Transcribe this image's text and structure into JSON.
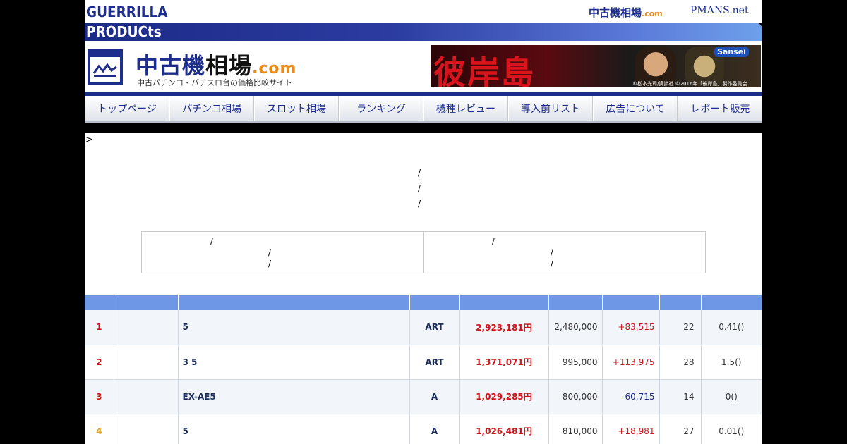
{
  "brand": {
    "line1": "GUERRILLA",
    "line2": "PRODUCts"
  },
  "top_links": {
    "site1_main": "中古機相場",
    "site1_com": ".com",
    "site2": "PMANS.net"
  },
  "header": {
    "site_name_a": "中古機",
    "site_name_b": "相場",
    "site_name_com": ".com",
    "tagline": "中古パチンコ・パチスロ台の価格比較サイト"
  },
  "banner": {
    "title": "彼岸島",
    "brand": "Sansei",
    "copyright": "©松本光司/講談社 ©2016年「彼岸島」製作委員会"
  },
  "nav": [
    "トップページ",
    "パチンコ相場",
    "スロット相場",
    "ランキング",
    "機種レビュー",
    "導入前リスト",
    "広告について",
    "レポート販売"
  ],
  "content": {
    "gt": ">",
    "slash": "/"
  },
  "colors": {
    "brand_blue": "#1d2d8c",
    "price_red": "#d0121b",
    "header_blue": "#6e97e6",
    "accent_orange": "#e98a1b"
  },
  "ranking": [
    {
      "rank": "1",
      "rank_color": "#d0121b",
      "name": "5",
      "type": "ART",
      "price": "2,923,181円",
      "prev": "2,480,000",
      "diff": "+83,515",
      "diff_color": "#d0121b",
      "count": "22",
      "ratio": "0.41()"
    },
    {
      "rank": "2",
      "rank_color": "#d0121b",
      "name": "3 5",
      "type": "ART",
      "price": "1,371,071円",
      "prev": "995,000",
      "diff": "+113,975",
      "diff_color": "#d0121b",
      "count": "28",
      "ratio": "1.5()"
    },
    {
      "rank": "3",
      "rank_color": "#d0121b",
      "name": "EX-AE5",
      "type": "A",
      "price": "1,029,285円",
      "prev": "800,000",
      "diff": "-60,715",
      "diff_color": "#1d2d8c",
      "count": "14",
      "ratio": "0()"
    },
    {
      "rank": "4",
      "rank_color": "#e0a21a",
      "name": "5",
      "type": "A",
      "price": "1,026,481円",
      "prev": "810,000",
      "diff": "+18,981",
      "diff_color": "#d0121b",
      "count": "27",
      "ratio": "0.01()"
    }
  ]
}
